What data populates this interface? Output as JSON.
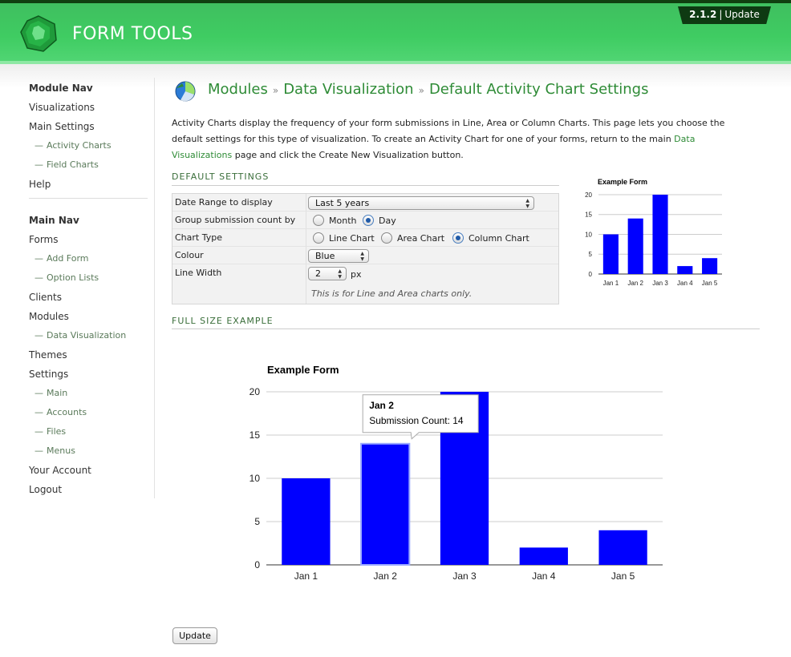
{
  "header": {
    "brand": "FORM TOOLS",
    "version": "2.1.2",
    "version_separator": "|",
    "update_link": "Update"
  },
  "sidebar": {
    "module_nav_title": "Module Nav",
    "module_items": [
      {
        "label": "Visualizations",
        "level": 0
      },
      {
        "label": "Main Settings",
        "level": 0
      },
      {
        "label": "Activity Charts",
        "level": 1
      },
      {
        "label": "Field Charts",
        "level": 1
      },
      {
        "label": "Help",
        "level": 0
      }
    ],
    "main_nav_title": "Main Nav",
    "main_items": [
      {
        "label": "Forms",
        "level": 0
      },
      {
        "label": "Add Form",
        "level": 1
      },
      {
        "label": "Option Lists",
        "level": 1
      },
      {
        "label": "Clients",
        "level": 0
      },
      {
        "label": "Modules",
        "level": 0
      },
      {
        "label": "Data Visualization",
        "level": 1
      },
      {
        "label": "Themes",
        "level": 0
      },
      {
        "label": "Settings",
        "level": 0
      },
      {
        "label": "Main",
        "level": 1
      },
      {
        "label": "Accounts",
        "level": 1
      },
      {
        "label": "Files",
        "level": 1
      },
      {
        "label": "Menus",
        "level": 1
      },
      {
        "label": "Your Account",
        "level": 0
      },
      {
        "label": "Logout",
        "level": 0
      }
    ],
    "sub_dash": "—"
  },
  "breadcrumb": {
    "items": [
      "Modules",
      "Data Visualization"
    ],
    "current": "Default Activity Chart Settings",
    "separator": "»"
  },
  "intro": {
    "text1": "Activity Charts display the frequency of your form submissions in Line, Area or Column Charts. This page lets you choose the default settings for this type of visualization. To create an Activity Chart for one of your forms, return to the main ",
    "link": "Data Visualizations",
    "text2": " page and click the Create New Visualization button."
  },
  "default_settings": {
    "heading": "DEFAULT SETTINGS",
    "date_range_label": "Date Range to display",
    "date_range_value": "Last 5 years",
    "group_label": "Group submission count by",
    "group_options": [
      "Month",
      "Day"
    ],
    "group_selected": "Day",
    "chart_type_label": "Chart Type",
    "chart_type_options": [
      "Line Chart",
      "Area Chart",
      "Column Chart"
    ],
    "chart_type_selected": "Column Chart",
    "colour_label": "Colour",
    "colour_value": "Blue",
    "line_width_label": "Line Width",
    "line_width_value": "2",
    "line_width_unit": "px",
    "line_width_note": "This is for Line and Area charts only."
  },
  "full_size": {
    "heading": "FULL SIZE EXAMPLE"
  },
  "tooltip": {
    "title": "Jan 2",
    "text": "Submission Count: 14"
  },
  "update_button": "Update",
  "colors": {
    "brand_green": "#3fcc62",
    "link_green": "#2e8b36",
    "bar_blue": "#0000ff"
  },
  "chart_data": [
    {
      "type": "bar",
      "title": "Example Form",
      "categories": [
        "Jan 1",
        "Jan 2",
        "Jan 3",
        "Jan 4",
        "Jan 5"
      ],
      "values": [
        10,
        14,
        20,
        2,
        4
      ],
      "ylim": [
        0,
        20
      ],
      "yticks": [
        0,
        5,
        10,
        15,
        20
      ],
      "grid": true,
      "legend": "none"
    },
    {
      "type": "bar",
      "title": "Example Form",
      "categories": [
        "Jan 1",
        "Jan 2",
        "Jan 3",
        "Jan 4",
        "Jan 5"
      ],
      "values": [
        10,
        14,
        20,
        2,
        4
      ],
      "ylim": [
        0,
        20
      ],
      "yticks": [
        0,
        5,
        10,
        15,
        20
      ],
      "grid": true,
      "legend": "none",
      "highlighted": "Jan 2"
    }
  ]
}
